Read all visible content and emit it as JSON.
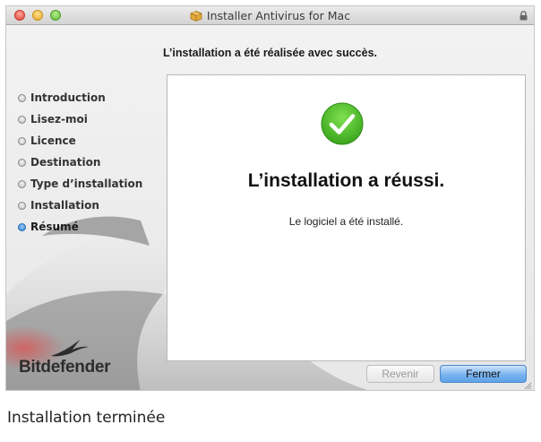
{
  "window": {
    "title": "Installer Antivirus for Mac",
    "heading": "L’installation a été réalisée avec succès."
  },
  "sidebar": {
    "steps": [
      {
        "label": "Introduction",
        "active": false
      },
      {
        "label": "Lisez-moi",
        "active": false
      },
      {
        "label": "Licence",
        "active": false
      },
      {
        "label": "Destination",
        "active": false
      },
      {
        "label": "Type d’installation",
        "active": false
      },
      {
        "label": "Installation",
        "active": false
      },
      {
        "label": "Résumé",
        "active": true
      }
    ],
    "brand": "Bitdefender"
  },
  "main": {
    "status_icon": "check-circle-icon",
    "success_title": "L’installation a réussi.",
    "success_message": "Le logiciel a été installé."
  },
  "buttons": {
    "back_label": "Revenir",
    "close_label": "Fermer"
  },
  "caption": "Installation terminée",
  "colors": {
    "success_green": "#4cbb2c",
    "default_button_blue": "#6aaaea",
    "active_step_blue": "#2f7fd3"
  }
}
